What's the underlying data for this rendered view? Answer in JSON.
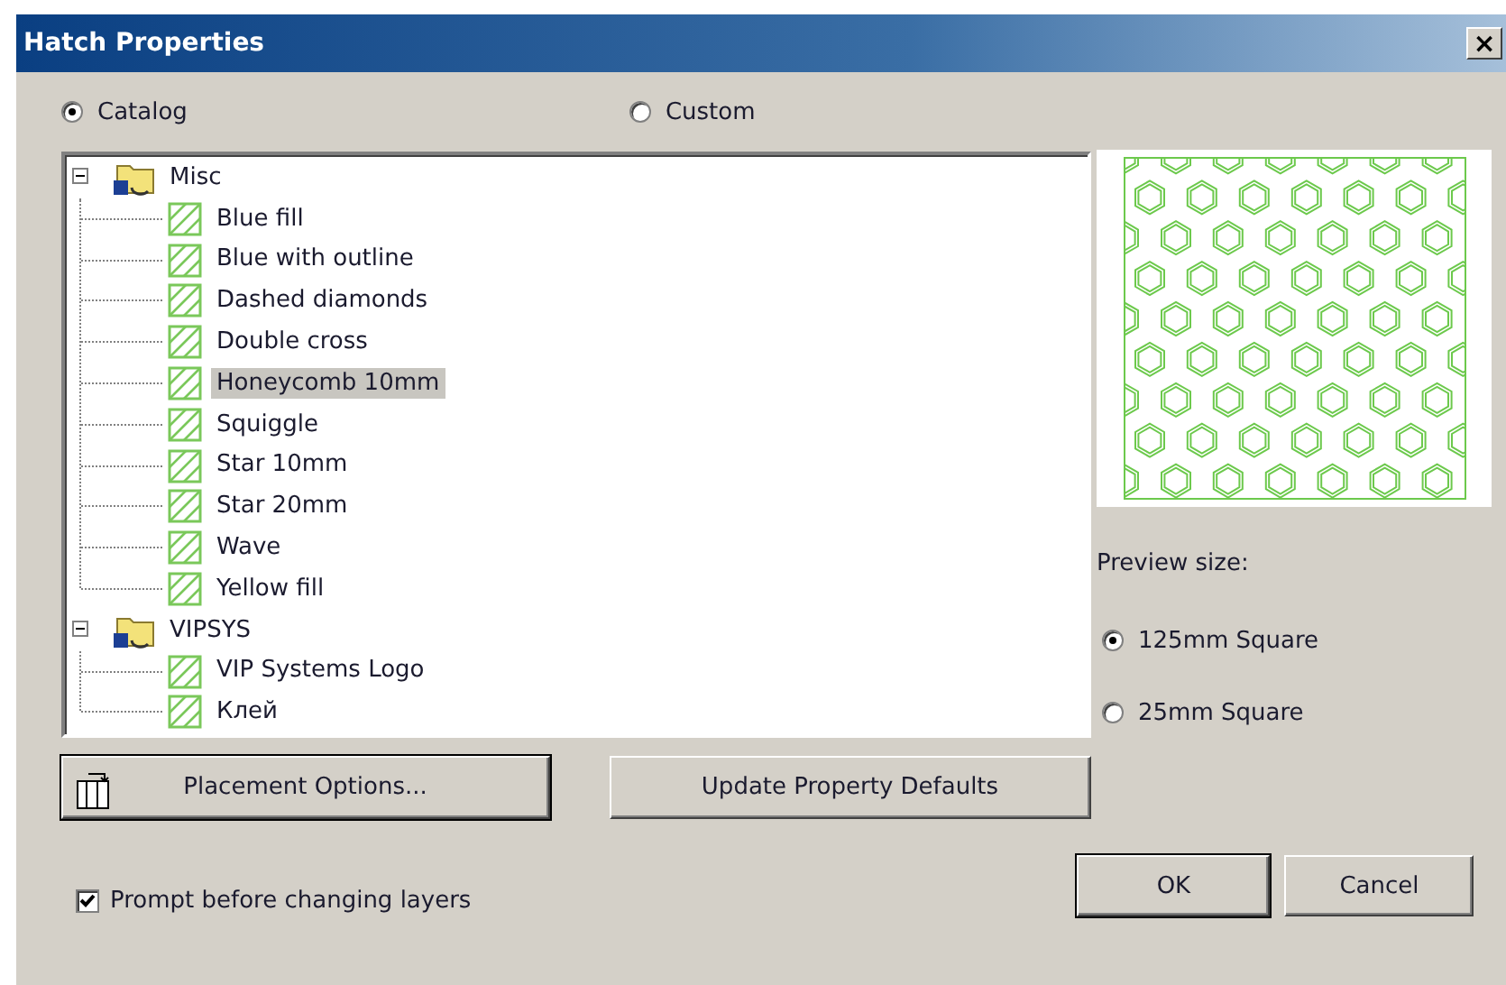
{
  "window": {
    "title": "Hatch Properties",
    "close": "×"
  },
  "source": [
    {
      "label": "Catalog",
      "selected": true
    },
    {
      "label": "Custom",
      "selected": false
    }
  ],
  "tree": [
    {
      "label": "Misc",
      "expanded": true,
      "children": [
        {
          "label": "Blue fill",
          "selected": false
        },
        {
          "label": "Blue with outline",
          "selected": false
        },
        {
          "label": "Dashed diamonds",
          "selected": false
        },
        {
          "label": "Double cross",
          "selected": false
        },
        {
          "label": "Honeycomb 10mm",
          "selected": true
        },
        {
          "label": "Squiggle",
          "selected": false
        },
        {
          "label": "Star 10mm",
          "selected": false
        },
        {
          "label": "Star 20mm",
          "selected": false
        },
        {
          "label": "Wave",
          "selected": false
        },
        {
          "label": "Yellow fill",
          "selected": false
        }
      ]
    },
    {
      "label": "VIPSYS",
      "expanded": true,
      "children": [
        {
          "label": "VIP Systems Logo",
          "selected": false
        },
        {
          "label": "Клей",
          "selected": false
        }
      ]
    }
  ],
  "preview_size": {
    "label": "Preview size:",
    "options": [
      {
        "label": "125mm Square",
        "selected": true
      },
      {
        "label": "25mm Square",
        "selected": false
      }
    ]
  },
  "buttons": {
    "placement": "Placement Options...",
    "update": "Update Property Defaults",
    "ok": "OK",
    "cancel": "Cancel"
  },
  "prompt": {
    "label": "Prompt before changing layers",
    "checked": true
  }
}
